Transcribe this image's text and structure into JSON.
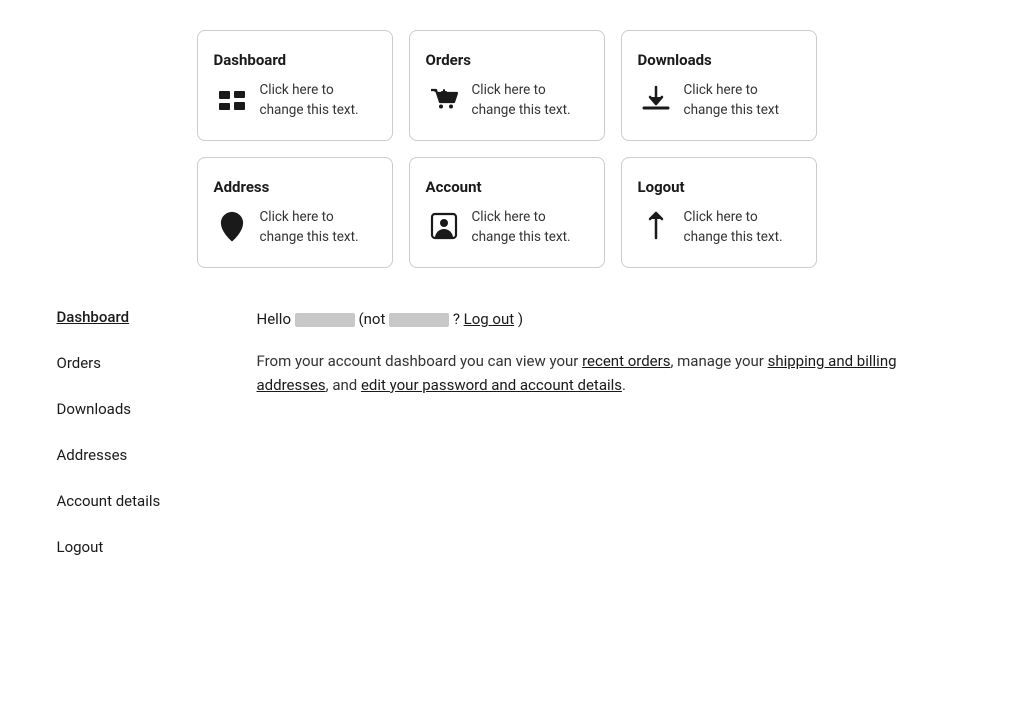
{
  "tiles": [
    {
      "id": "dashboard",
      "label": "Dashboard",
      "text": "Click here to change this text.",
      "icon": "dashboard"
    },
    {
      "id": "orders",
      "label": "Orders",
      "text": "Click here to change this text.",
      "icon": "orders"
    },
    {
      "id": "downloads",
      "label": "Downloads",
      "text": "Click here to change this text",
      "icon": "downloads"
    },
    {
      "id": "address",
      "label": "Address",
      "text": "Click here to change this text.",
      "icon": "address"
    },
    {
      "id": "account",
      "label": "Account",
      "text": "Click here to change this text.",
      "icon": "account"
    },
    {
      "id": "logout",
      "label": "Logout",
      "text": "Click here to change this text.",
      "icon": "logout"
    }
  ],
  "sidebar": {
    "items": [
      {
        "id": "dashboard",
        "label": "Dashboard",
        "active": true
      },
      {
        "id": "orders",
        "label": "Orders",
        "active": false
      },
      {
        "id": "downloads",
        "label": "Downloads",
        "active": false
      },
      {
        "id": "addresses",
        "label": "Addresses",
        "active": false
      },
      {
        "id": "account-details",
        "label": "Account details",
        "active": false
      },
      {
        "id": "logout",
        "label": "Logout",
        "active": false
      }
    ]
  },
  "main": {
    "hello_prefix": "Hello",
    "hello_not": "not",
    "hello_suffix": "?",
    "logout_link": "Log out",
    "description_start": "From your account dashboard you can view your",
    "recent_orders_link": "recent orders",
    "description_mid": ", manage your",
    "shipping_link": "shipping and billing addresses",
    "description_mid2": ", and",
    "edit_link": "edit your password and account details",
    "description_end": "."
  }
}
